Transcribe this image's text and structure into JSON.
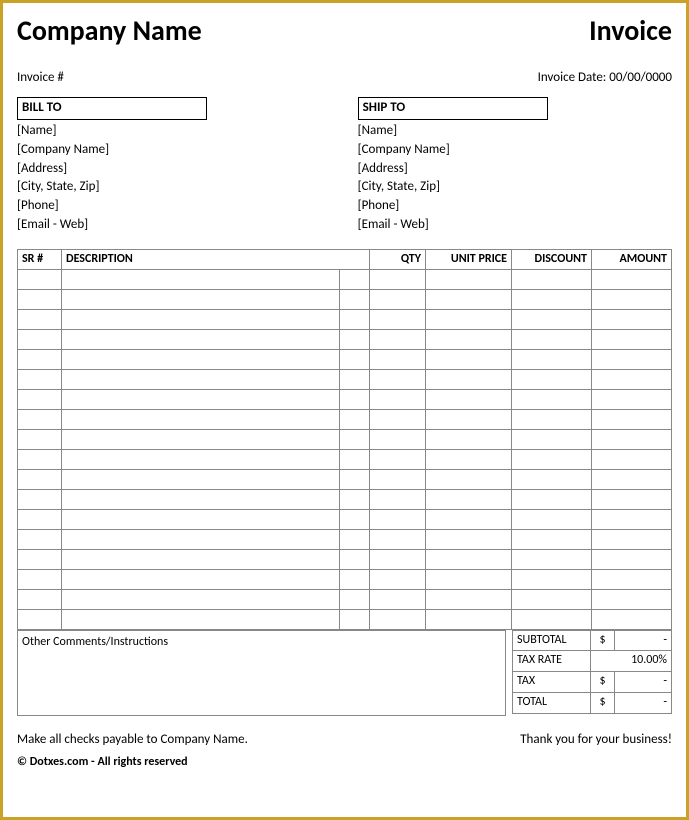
{
  "header": {
    "company": "Company Name",
    "title": "Invoice",
    "invoice_no_label": "Invoice #",
    "invoice_date_label": "Invoice Date:",
    "invoice_date_value": "00/00/0000"
  },
  "bill_to": {
    "title": "BILL TO",
    "name": "[Name]",
    "company": "[Company Name]",
    "address": "[Address]",
    "city": "[City, State, Zip]",
    "phone": "[Phone]",
    "email": "[Email - Web]"
  },
  "ship_to": {
    "title": "SHIP TO",
    "name": "[Name]",
    "company": "[Company Name]",
    "address": "[Address]",
    "city": "[City, State, Zip]",
    "phone": "[Phone]",
    "email": "[Email - Web]"
  },
  "cols": {
    "sr": "SR #",
    "desc": "DESCRIPTION",
    "qty": "QTY",
    "unit": "UNIT PRICE",
    "disc": "DISCOUNT",
    "amt": "AMOUNT"
  },
  "comments_label": "Other Comments/Instructions",
  "totals": {
    "subtotal_label": "SUBTOTAL",
    "subtotal_cur": "$",
    "subtotal_val": "-",
    "taxrate_label": "TAX RATE",
    "taxrate_val": "10.00%",
    "tax_label": "TAX",
    "tax_cur": "$",
    "tax_val": "-",
    "total_label": "TOTAL",
    "total_cur": "$",
    "total_val": "-"
  },
  "footer": {
    "payable": "Make all checks payable to Company Name.",
    "thanks": "Thank you for your business!",
    "copyright": "© Dotxes.com - All rights reserved"
  }
}
